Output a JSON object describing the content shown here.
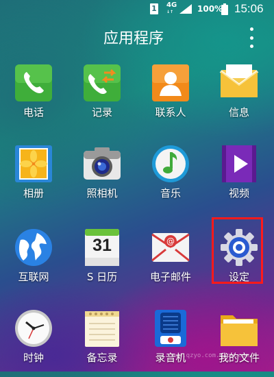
{
  "status_bar": {
    "sim_slot": "1",
    "network": "4G",
    "network_sub": "↓↑",
    "battery": "100%",
    "time": "15:06"
  },
  "header": {
    "title": "应用程序"
  },
  "apps": [
    {
      "label": "电话",
      "icon": "phone-icon"
    },
    {
      "label": "记录",
      "icon": "call-log-icon"
    },
    {
      "label": "联系人",
      "icon": "contacts-icon"
    },
    {
      "label": "信息",
      "icon": "messages-icon"
    },
    {
      "label": "相册",
      "icon": "gallery-icon"
    },
    {
      "label": "照相机",
      "icon": "camera-icon"
    },
    {
      "label": "音乐",
      "icon": "music-icon"
    },
    {
      "label": "视频",
      "icon": "video-icon"
    },
    {
      "label": "互联网",
      "icon": "internet-icon"
    },
    {
      "label": "S 日历",
      "icon": "calendar-icon",
      "date": "31"
    },
    {
      "label": "电子邮件",
      "icon": "email-icon"
    },
    {
      "label": "设定",
      "icon": "settings-icon"
    },
    {
      "label": "时钟",
      "icon": "clock-icon"
    },
    {
      "label": "备忘录",
      "icon": "memo-icon"
    },
    {
      "label": "录音机",
      "icon": "voice-recorder-icon"
    },
    {
      "label": "我的文件",
      "icon": "my-files-icon"
    }
  ],
  "highlight": {
    "target": "设定",
    "color": "#ff1a1a"
  },
  "watermark": "www.qzyo.com.qzqw.com"
}
